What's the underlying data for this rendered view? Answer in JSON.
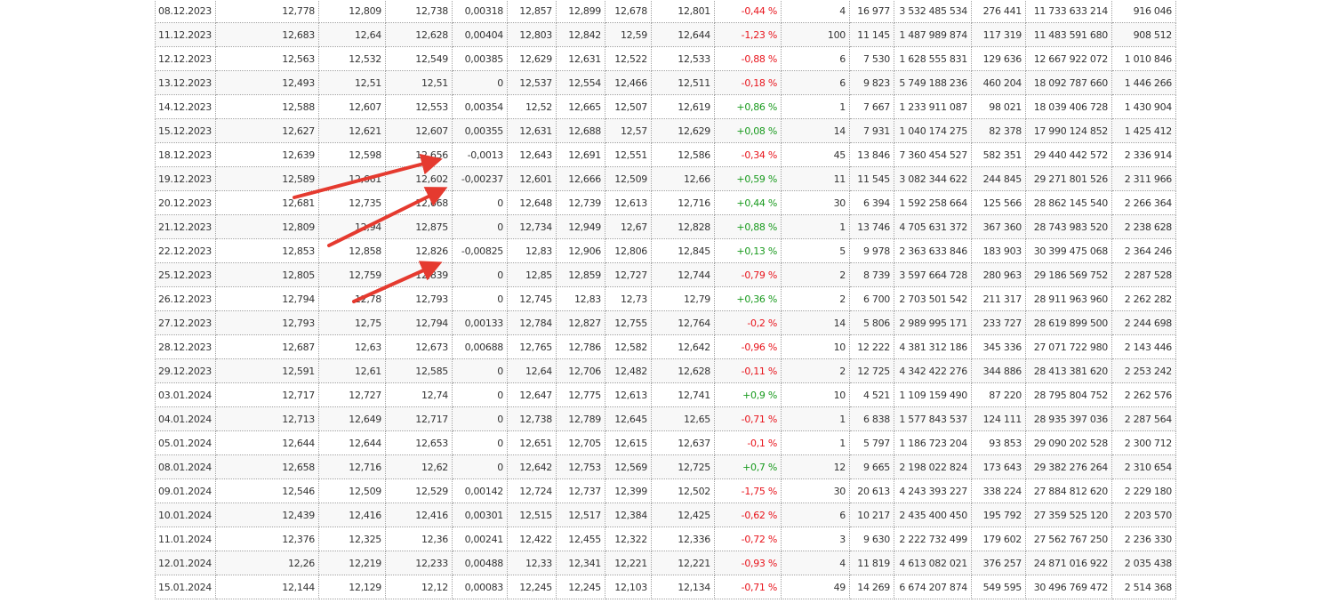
{
  "colors": {
    "negative": "#e8141c",
    "positive": "#189a1d",
    "arrow": "#e53a2f"
  },
  "rows": [
    [
      "08.12.2023",
      "12,778",
      "12,809",
      "12,738",
      "0,00318",
      "12,857",
      "12,899",
      "12,678",
      "12,801",
      "-0,44 %",
      "4",
      "16 977",
      "3 532 485 534",
      "276 441",
      "11 733 633 214",
      "916 046"
    ],
    [
      "11.12.2023",
      "12,683",
      "12,64",
      "12,628",
      "0,00404",
      "12,803",
      "12,842",
      "12,59",
      "12,644",
      "-1,23 %",
      "100",
      "11 145",
      "1 487 989 874",
      "117 319",
      "11 483 591 680",
      "908 512"
    ],
    [
      "12.12.2023",
      "12,563",
      "12,532",
      "12,549",
      "0,00385",
      "12,629",
      "12,631",
      "12,522",
      "12,533",
      "-0,88 %",
      "6",
      "7 530",
      "1 628 555 831",
      "129 636",
      "12 667 922 072",
      "1 010 846"
    ],
    [
      "13.12.2023",
      "12,493",
      "12,51",
      "12,51",
      "0",
      "12,537",
      "12,554",
      "12,466",
      "12,511",
      "-0,18 %",
      "6",
      "9 823",
      "5 749 188 236",
      "460 204",
      "18 092 787 660",
      "1 446 266"
    ],
    [
      "14.12.2023",
      "12,588",
      "12,607",
      "12,553",
      "0,00354",
      "12,52",
      "12,665",
      "12,507",
      "12,619",
      "+0,86 %",
      "1",
      "7 667",
      "1 233 911 087",
      "98 021",
      "18 039 406 728",
      "1 430 904"
    ],
    [
      "15.12.2023",
      "12,627",
      "12,621",
      "12,607",
      "0,00355",
      "12,631",
      "12,688",
      "12,57",
      "12,629",
      "+0,08 %",
      "14",
      "7 931",
      "1 040 174 275",
      "82 378",
      "17 990 124 852",
      "1 425 412"
    ],
    [
      "18.12.2023",
      "12,639",
      "12,598",
      "12,656",
      "-0,0013",
      "12,643",
      "12,691",
      "12,551",
      "12,586",
      "-0,34 %",
      "45",
      "13 846",
      "7 360 454 527",
      "582 351",
      "29 440 442 572",
      "2 336 914"
    ],
    [
      "19.12.2023",
      "12,589",
      "12,661",
      "12,602",
      "-0,00237",
      "12,601",
      "12,666",
      "12,509",
      "12,66",
      "+0,59 %",
      "11",
      "11 545",
      "3 082 344 622",
      "244 845",
      "29 271 801 526",
      "2 311 966"
    ],
    [
      "20.12.2023",
      "12,681",
      "12,735",
      "12,668",
      "0",
      "12,648",
      "12,739",
      "12,613",
      "12,716",
      "+0,44 %",
      "30",
      "6 394",
      "1 592 258 664",
      "125 566",
      "28 862 145 540",
      "2 266 364"
    ],
    [
      "21.12.2023",
      "12,809",
      "12,94",
      "12,875",
      "0",
      "12,734",
      "12,949",
      "12,67",
      "12,828",
      "+0,88 %",
      "1",
      "13 746",
      "4 705 631 372",
      "367 360",
      "28 743 983 520",
      "2 238 628"
    ],
    [
      "22.12.2023",
      "12,853",
      "12,858",
      "12,826",
      "-0,00825",
      "12,83",
      "12,906",
      "12,806",
      "12,845",
      "+0,13 %",
      "5",
      "9 978",
      "2 363 633 846",
      "183 903",
      "30 399 475 068",
      "2 364 246"
    ],
    [
      "25.12.2023",
      "12,805",
      "12,759",
      "12,839",
      "0",
      "12,85",
      "12,859",
      "12,727",
      "12,744",
      "-0,79 %",
      "2",
      "8 739",
      "3 597 664 728",
      "280 963",
      "29 186 569 752",
      "2 287 528"
    ],
    [
      "26.12.2023",
      "12,794",
      "12,78",
      "12,793",
      "0",
      "12,745",
      "12,83",
      "12,73",
      "12,79",
      "+0,36 %",
      "2",
      "6 700",
      "2 703 501 542",
      "211 317",
      "28 911 963 960",
      "2 262 282"
    ],
    [
      "27.12.2023",
      "12,793",
      "12,75",
      "12,794",
      "0,00133",
      "12,784",
      "12,827",
      "12,755",
      "12,764",
      "-0,2 %",
      "14",
      "5 806",
      "2 989 995 171",
      "233 727",
      "28 619 899 500",
      "2 244 698"
    ],
    [
      "28.12.2023",
      "12,687",
      "12,63",
      "12,673",
      "0,00688",
      "12,765",
      "12,786",
      "12,582",
      "12,642",
      "-0,96 %",
      "10",
      "12 222",
      "4 381 312 186",
      "345 336",
      "27 071 722 980",
      "2 143 446"
    ],
    [
      "29.12.2023",
      "12,591",
      "12,61",
      "12,585",
      "0",
      "12,64",
      "12,706",
      "12,482",
      "12,628",
      "-0,11 %",
      "2",
      "12 725",
      "4 342 422 276",
      "344 886",
      "28 413 381 620",
      "2 253 242"
    ],
    [
      "03.01.2024",
      "12,717",
      "12,727",
      "12,74",
      "0",
      "12,647",
      "12,775",
      "12,613",
      "12,741",
      "+0,9 %",
      "10",
      "4 521",
      "1 109 159 490",
      "87 220",
      "28 795 804 752",
      "2 262 576"
    ],
    [
      "04.01.2024",
      "12,713",
      "12,649",
      "12,717",
      "0",
      "12,738",
      "12,789",
      "12,645",
      "12,65",
      "-0,71 %",
      "1",
      "6 838",
      "1 577 843 537",
      "124 111",
      "28 935 397 036",
      "2 287 564"
    ],
    [
      "05.01.2024",
      "12,644",
      "12,644",
      "12,653",
      "0",
      "12,651",
      "12,705",
      "12,615",
      "12,637",
      "-0,1 %",
      "1",
      "5 797",
      "1 186 723 204",
      "93 853",
      "29 090 202 528",
      "2 300 712"
    ],
    [
      "08.01.2024",
      "12,658",
      "12,716",
      "12,62",
      "0",
      "12,642",
      "12,753",
      "12,569",
      "12,725",
      "+0,7 %",
      "12",
      "9 665",
      "2 198 022 824",
      "173 643",
      "29 382 276 264",
      "2 310 654"
    ],
    [
      "09.01.2024",
      "12,546",
      "12,509",
      "12,529",
      "0,00142",
      "12,724",
      "12,737",
      "12,399",
      "12,502",
      "-1,75 %",
      "30",
      "20 613",
      "4 243 393 227",
      "338 224",
      "27 884 812 620",
      "2 229 180"
    ],
    [
      "10.01.2024",
      "12,439",
      "12,416",
      "12,416",
      "0,00301",
      "12,515",
      "12,517",
      "12,384",
      "12,425",
      "-0,62 %",
      "6",
      "10 217",
      "2 435 400 450",
      "195 792",
      "27 359 525 120",
      "2 203 570"
    ],
    [
      "11.01.2024",
      "12,376",
      "12,325",
      "12,36",
      "0,00241",
      "12,422",
      "12,455",
      "12,322",
      "12,336",
      "-0,72 %",
      "3",
      "9 630",
      "2 222 732 499",
      "179 602",
      "27 562 767 250",
      "2 236 330"
    ],
    [
      "12.01.2024",
      "12,26",
      "12,219",
      "12,233",
      "0,00488",
      "12,33",
      "12,341",
      "12,221",
      "12,221",
      "-0,93 %",
      "4",
      "11 819",
      "4 613 082 021",
      "376 257",
      "24 871 016 922",
      "2 035 438"
    ],
    [
      "15.01.2024",
      "12,144",
      "12,129",
      "12,12",
      "0,00083",
      "12,245",
      "12,245",
      "12,103",
      "12,134",
      "-0,71 %",
      "49",
      "14 269",
      "6 674 207 874",
      "549 595",
      "30 496 769 472",
      "2 514 368"
    ]
  ]
}
